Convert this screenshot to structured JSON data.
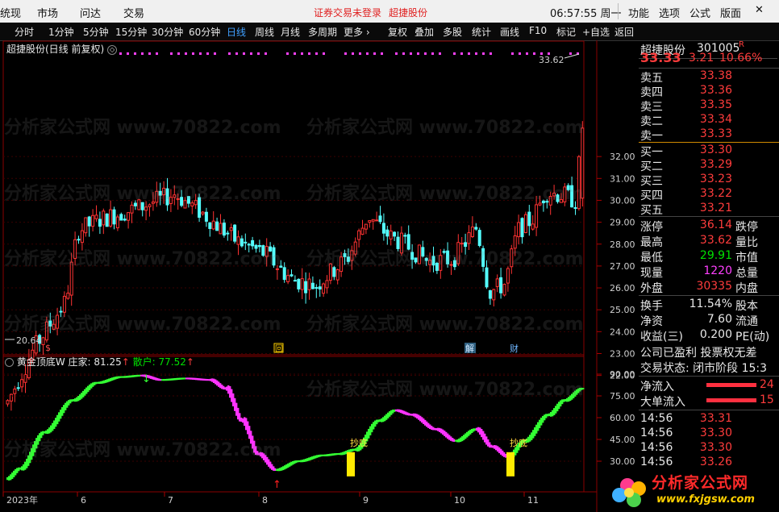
{
  "topbar": {
    "menu_left": [
      "统现",
      "市场",
      "问达",
      "交易"
    ],
    "notice": "证券交易未登录",
    "stock_link": "超捷股份",
    "clock": "06:57:55 周一",
    "menu_right": [
      "功能",
      "选项",
      "公式",
      "版面"
    ],
    "win_buttons": [
      "–",
      "□",
      "✕"
    ]
  },
  "toolbar": {
    "periods": [
      "分时",
      "1分钟",
      "5分钟",
      "15分钟",
      "30分钟",
      "60分钟",
      "日线",
      "周线",
      "月线",
      "多周期",
      "更多 ›"
    ],
    "active_period": "日线",
    "tools": [
      "复权",
      "叠加",
      "多股",
      "统计",
      "画线",
      "F10",
      "标记",
      "+自选",
      "返回"
    ]
  },
  "chart": {
    "title": "超捷股份(日线 前复权)",
    "high_label": "33.62",
    "low_label": "20.64",
    "price_axis": [
      "32.00",
      "31.00",
      "30.00",
      "29.00",
      "28.00",
      "27.00",
      "26.00",
      "25.00",
      "24.00",
      "23.00",
      "22.00"
    ],
    "event_markers": [
      "$",
      "回",
      "解",
      "财"
    ],
    "watermark": "分析家公式网 www.70822.com"
  },
  "indicator": {
    "name": "黄金顶底W",
    "zhuang_label": "庄家:",
    "zhuang_value": "81.25",
    "sanhu_label": "散户:",
    "sanhu_value": "77.52",
    "signal_label": "抄底",
    "axis": [
      "90.00",
      "75.00",
      "60.00",
      "45.00",
      "30.00"
    ]
  },
  "xaxis": [
    "2023年",
    "6",
    "7",
    "8",
    "9",
    "10",
    "11"
  ],
  "quote": {
    "name": "超捷股份",
    "code": "301005",
    "flag": "R",
    "price": "33.33",
    "change": "3.21",
    "pct": "10.66%",
    "asks": [
      {
        "label": "卖五",
        "price": "33.38"
      },
      {
        "label": "卖四",
        "price": "33.36"
      },
      {
        "label": "卖三",
        "price": "33.35"
      },
      {
        "label": "卖二",
        "price": "33.34"
      },
      {
        "label": "卖一",
        "price": "33.33"
      }
    ],
    "bids": [
      {
        "label": "买一",
        "price": "33.30"
      },
      {
        "label": "买二",
        "price": "33.29"
      },
      {
        "label": "买三",
        "price": "33.23"
      },
      {
        "label": "买四",
        "price": "33.22"
      },
      {
        "label": "买五",
        "price": "33.21"
      }
    ],
    "stats": [
      {
        "label": "涨停",
        "value": "36.14",
        "label2": "跌停"
      },
      {
        "label": "最高",
        "value": "33.62",
        "label2": "量比"
      },
      {
        "label": "最低",
        "value": "29.91",
        "label2": "市值"
      },
      {
        "label": "现量",
        "value": "1220",
        "label2": "总量"
      },
      {
        "label": "外盘",
        "value": "30335",
        "label2": "内盘"
      }
    ],
    "fund": [
      {
        "label": "换手",
        "value": "11.54%",
        "label2": "股本"
      },
      {
        "label": "净资",
        "value": "7.60",
        "label2": "流通"
      },
      {
        "label": "收益(三)",
        "value": "0.200",
        "label2": "PE(动)"
      }
    ],
    "info1": "公司已盈利 投票权无差",
    "info2": "交易状态: 闭市阶段 15:3",
    "flows": [
      {
        "label": "净流入",
        "value": "24"
      },
      {
        "label": "大单流入",
        "value": "15"
      }
    ],
    "ticks": [
      {
        "time": "14:56",
        "price": "33.31"
      },
      {
        "time": "14:56",
        "price": "33.30"
      },
      {
        "time": "14:56",
        "price": "33.30"
      },
      {
        "time": "14:56",
        "price": "33.26"
      }
    ]
  },
  "logo": {
    "text": "分析家公式网",
    "url": "www.fxjgsw.com"
  }
}
